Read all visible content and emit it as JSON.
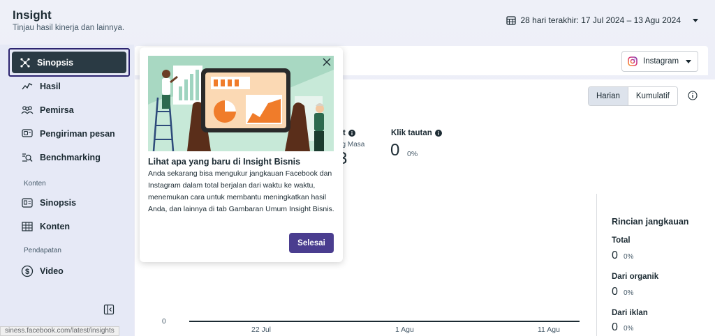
{
  "header": {
    "title": "Insight",
    "subtitle": "Tinjau hasil kinerja dan lainnya.",
    "date_range": "28 hari terakhir: 17 Jul 2024 – 13 Agu 2024"
  },
  "sidebar": {
    "active_item": "Sinopsis",
    "items": [
      {
        "label": "Hasil",
        "icon": "trend-line-icon"
      },
      {
        "label": "Pemirsa",
        "icon": "people-icon"
      },
      {
        "label": "Pengiriman pesan",
        "icon": "message-icon"
      },
      {
        "label": "Benchmarking",
        "icon": "benchmark-search-icon"
      }
    ],
    "section_konten": "Konten",
    "konten_items": [
      {
        "label": "Sinopsis",
        "icon": "content-overview-icon"
      },
      {
        "label": "Konten",
        "icon": "table-grid-icon"
      }
    ],
    "section_pendapatan": "Pendapatan",
    "pendapatan_items": [
      {
        "label": "Video",
        "icon": "dollar-circle-icon"
      }
    ]
  },
  "status_url": "siness.facebook.com/latest/insights",
  "platform_select": {
    "value": "Instagram"
  },
  "toggle": {
    "harian": "Harian",
    "kumulatif": "Kumulatif",
    "selected": "Harian"
  },
  "metrics": {
    "partial_label": "ut",
    "partial_sub": "ng Masa",
    "partial_value": "3",
    "link_clicks_label": "Klik tautan",
    "link_clicks_value": "0",
    "link_clicks_pct": "0%"
  },
  "breakdown": {
    "title": "Rincian jangkauan",
    "rows": [
      {
        "label": "Total",
        "value": "0",
        "pct": "0%"
      },
      {
        "label": "Dari organik",
        "value": "0",
        "pct": "0%"
      },
      {
        "label": "Dari iklan",
        "value": "0",
        "pct": "0%"
      }
    ]
  },
  "chart": {
    "y_zero": "0",
    "x_ticks": [
      "22 Jul",
      "1 Agu",
      "11 Agu"
    ]
  },
  "popup": {
    "title": "Lihat apa yang baru di Insight Bisnis",
    "body": "Anda sekarang bisa mengukur jangkauan Facebook dan Instagram dalam total berjalan dari waktu ke waktu, menemukan cara untuk membantu meningkatkan hasil Anda, dan lainnya di tab Gambaran Umum Insight Bisnis.",
    "button": "Selesai"
  },
  "colors": {
    "accent": "#4a3d8f",
    "active_nav": "#2a3a44",
    "focus_ring": "#2c2470"
  }
}
